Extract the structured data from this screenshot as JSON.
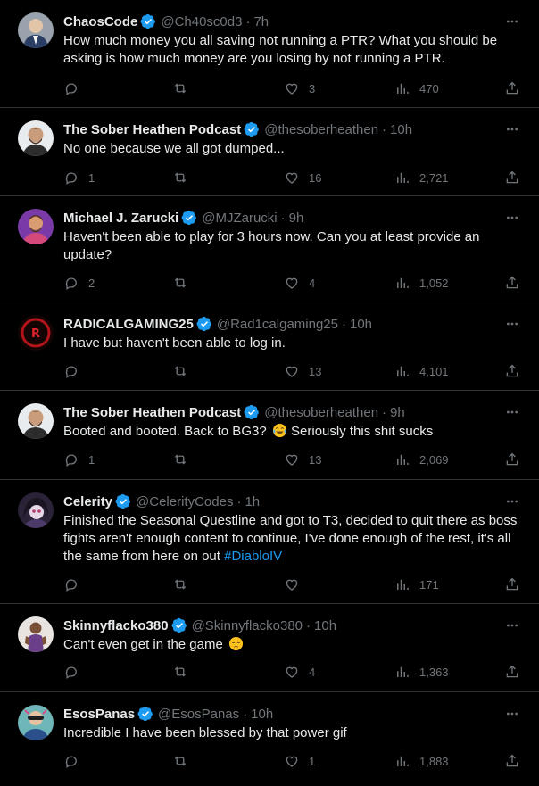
{
  "tweets": [
    {
      "name": "ChaosCode",
      "handle": "@Ch40sc0d3",
      "time": "7h",
      "text": "How much money you all saving not running a PTR? What you should be asking is how much money are you losing by not running a PTR.",
      "replies": "",
      "retweets": "",
      "likes": "3",
      "views": "470"
    },
    {
      "name": "The Sober Heathen Podcast",
      "handle": "@thesoberheathen",
      "time": "10h",
      "text": "No one because we all got dumped...",
      "replies": "1",
      "retweets": "",
      "likes": "16",
      "views": "2,721"
    },
    {
      "name": "Michael J. Zarucki",
      "handle": "@MJZarucki",
      "time": "9h",
      "text": "Haven't been able to play for 3 hours now. Can you at least provide an update?",
      "replies": "2",
      "retweets": "",
      "likes": "4",
      "views": "1,052"
    },
    {
      "name": "RADICALGAMING25",
      "handle": "@Rad1calgaming25",
      "time": "10h",
      "text": "I have but haven't been able to log in.",
      "replies": "",
      "retweets": "",
      "likes": "13",
      "views": "4,101"
    },
    {
      "name": "The Sober Heathen Podcast",
      "handle": "@thesoberheathen",
      "time": "9h",
      "text": "Booted and booted. Back to BG3?",
      "text_after_emoji": "Seriously this shit sucks",
      "emoji": "tears-of-joy-emoji",
      "replies": "1",
      "retweets": "",
      "likes": "13",
      "views": "2,069"
    },
    {
      "name": "Celerity",
      "handle": "@CelerityCodes",
      "time": "1h",
      "text": "Finished the Seasonal Questline and got to T3, decided to quit there as boss fights aren't enough content to continue, I've done enough of the rest, it's all the same from here on out",
      "hashtag": "#DiabloIV",
      "replies": "",
      "retweets": "",
      "likes": "",
      "views": "171"
    },
    {
      "name": "Skinnyflacko380",
      "handle": "@Skinnyflacko380",
      "time": "10h",
      "text": "Can't even get in the game",
      "emoji": "pensive-face-emoji",
      "replies": "",
      "retweets": "",
      "likes": "4",
      "views": "1,363"
    },
    {
      "name": "EsosPanas",
      "handle": "@EsosPanas",
      "time": "10h",
      "text": "Incredible I have been blessed by that power gif",
      "replies": "",
      "retweets": "",
      "likes": "1",
      "views": "1,883"
    }
  ],
  "colors": {
    "background": "#000000",
    "text": "#e7e9ea",
    "muted": "#71767b",
    "accent": "#1d9bf0",
    "divider": "#2f3336"
  }
}
